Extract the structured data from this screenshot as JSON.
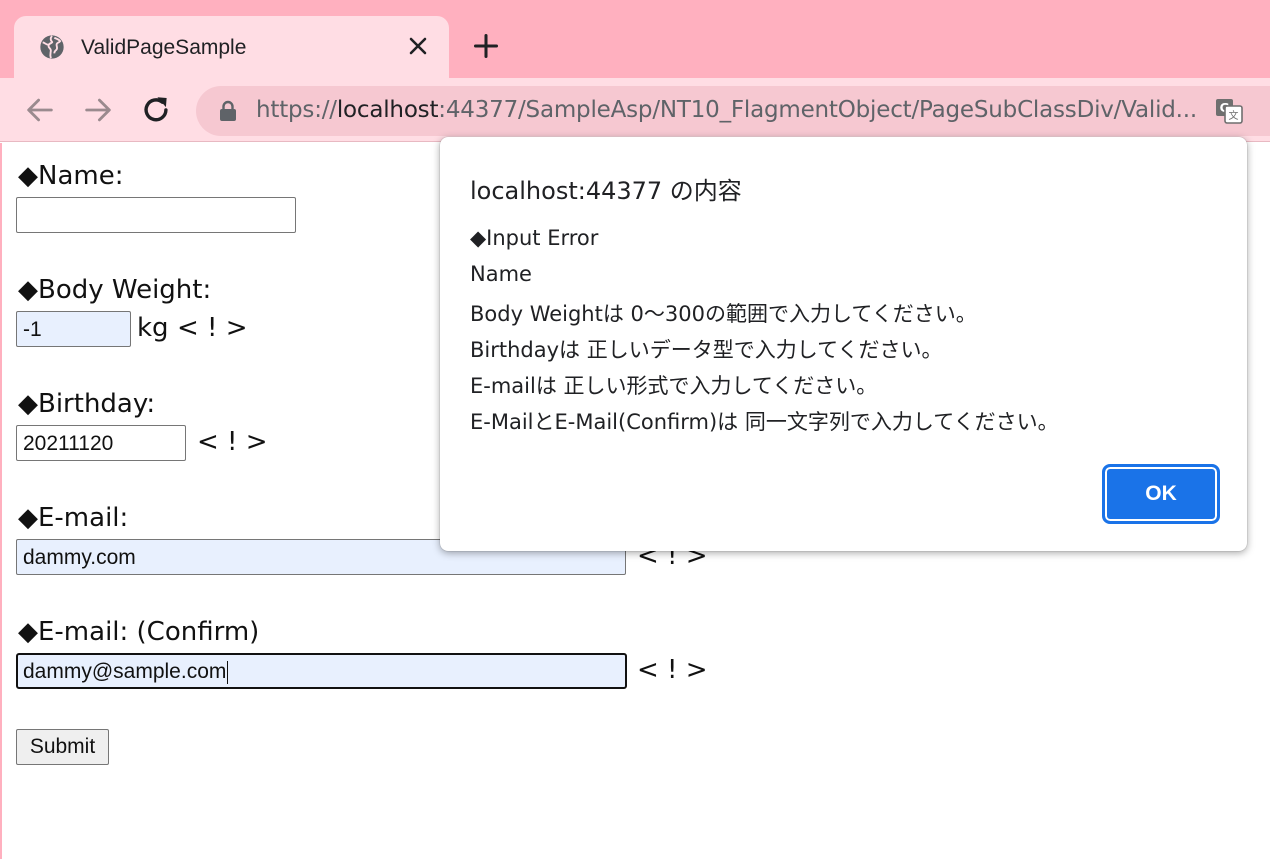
{
  "browser": {
    "tab_title": "ValidPageSample",
    "url_scheme": "https://",
    "url_host": "localhost",
    "url_rest": ":44377/SampleAsp/NT10_FlagmentObject/PageSubClassDiv/Valid..."
  },
  "form": {
    "name_label": "◆Name:",
    "name_value": "",
    "weight_label": "◆Body Weight:",
    "weight_value": "-1",
    "weight_unit": "kg",
    "weight_error": "< ! >",
    "birthday_label": "◆Birthday:",
    "birthday_value": "20211120",
    "birthday_error": "< ! >",
    "email_label": "◆E-mail:",
    "email_value": "dammy.com",
    "email_error": "< ! >",
    "email_confirm_label": "◆E-mail: (Confirm)",
    "email_confirm_value": "dammy@sample.com",
    "email_confirm_error": "< ! >",
    "submit_label": "Submit"
  },
  "dialog": {
    "title": "localhost:44377 の内容",
    "lines": [
      "◆Input Error",
      "Name",
      "Body Weightは 0〜300の範囲で入力してください。",
      "Birthdayは 正しいデータ型で入力してください。",
      "E-mailは 正しい形式で入力してください。",
      "E-MailとE-Mail(Confirm)は 同一文字列で入力してください。"
    ],
    "ok_label": "OK"
  },
  "colors": {
    "tabbar": "#ffb0bf",
    "toolbar": "#ffdde4",
    "autofill": "#e8f0fe",
    "ok_button": "#1a73e8"
  },
  "icons": [
    "globe-icon",
    "close-icon",
    "plus-icon",
    "back-arrow-icon",
    "forward-arrow-icon",
    "reload-icon",
    "lock-icon",
    "translate-icon"
  ]
}
